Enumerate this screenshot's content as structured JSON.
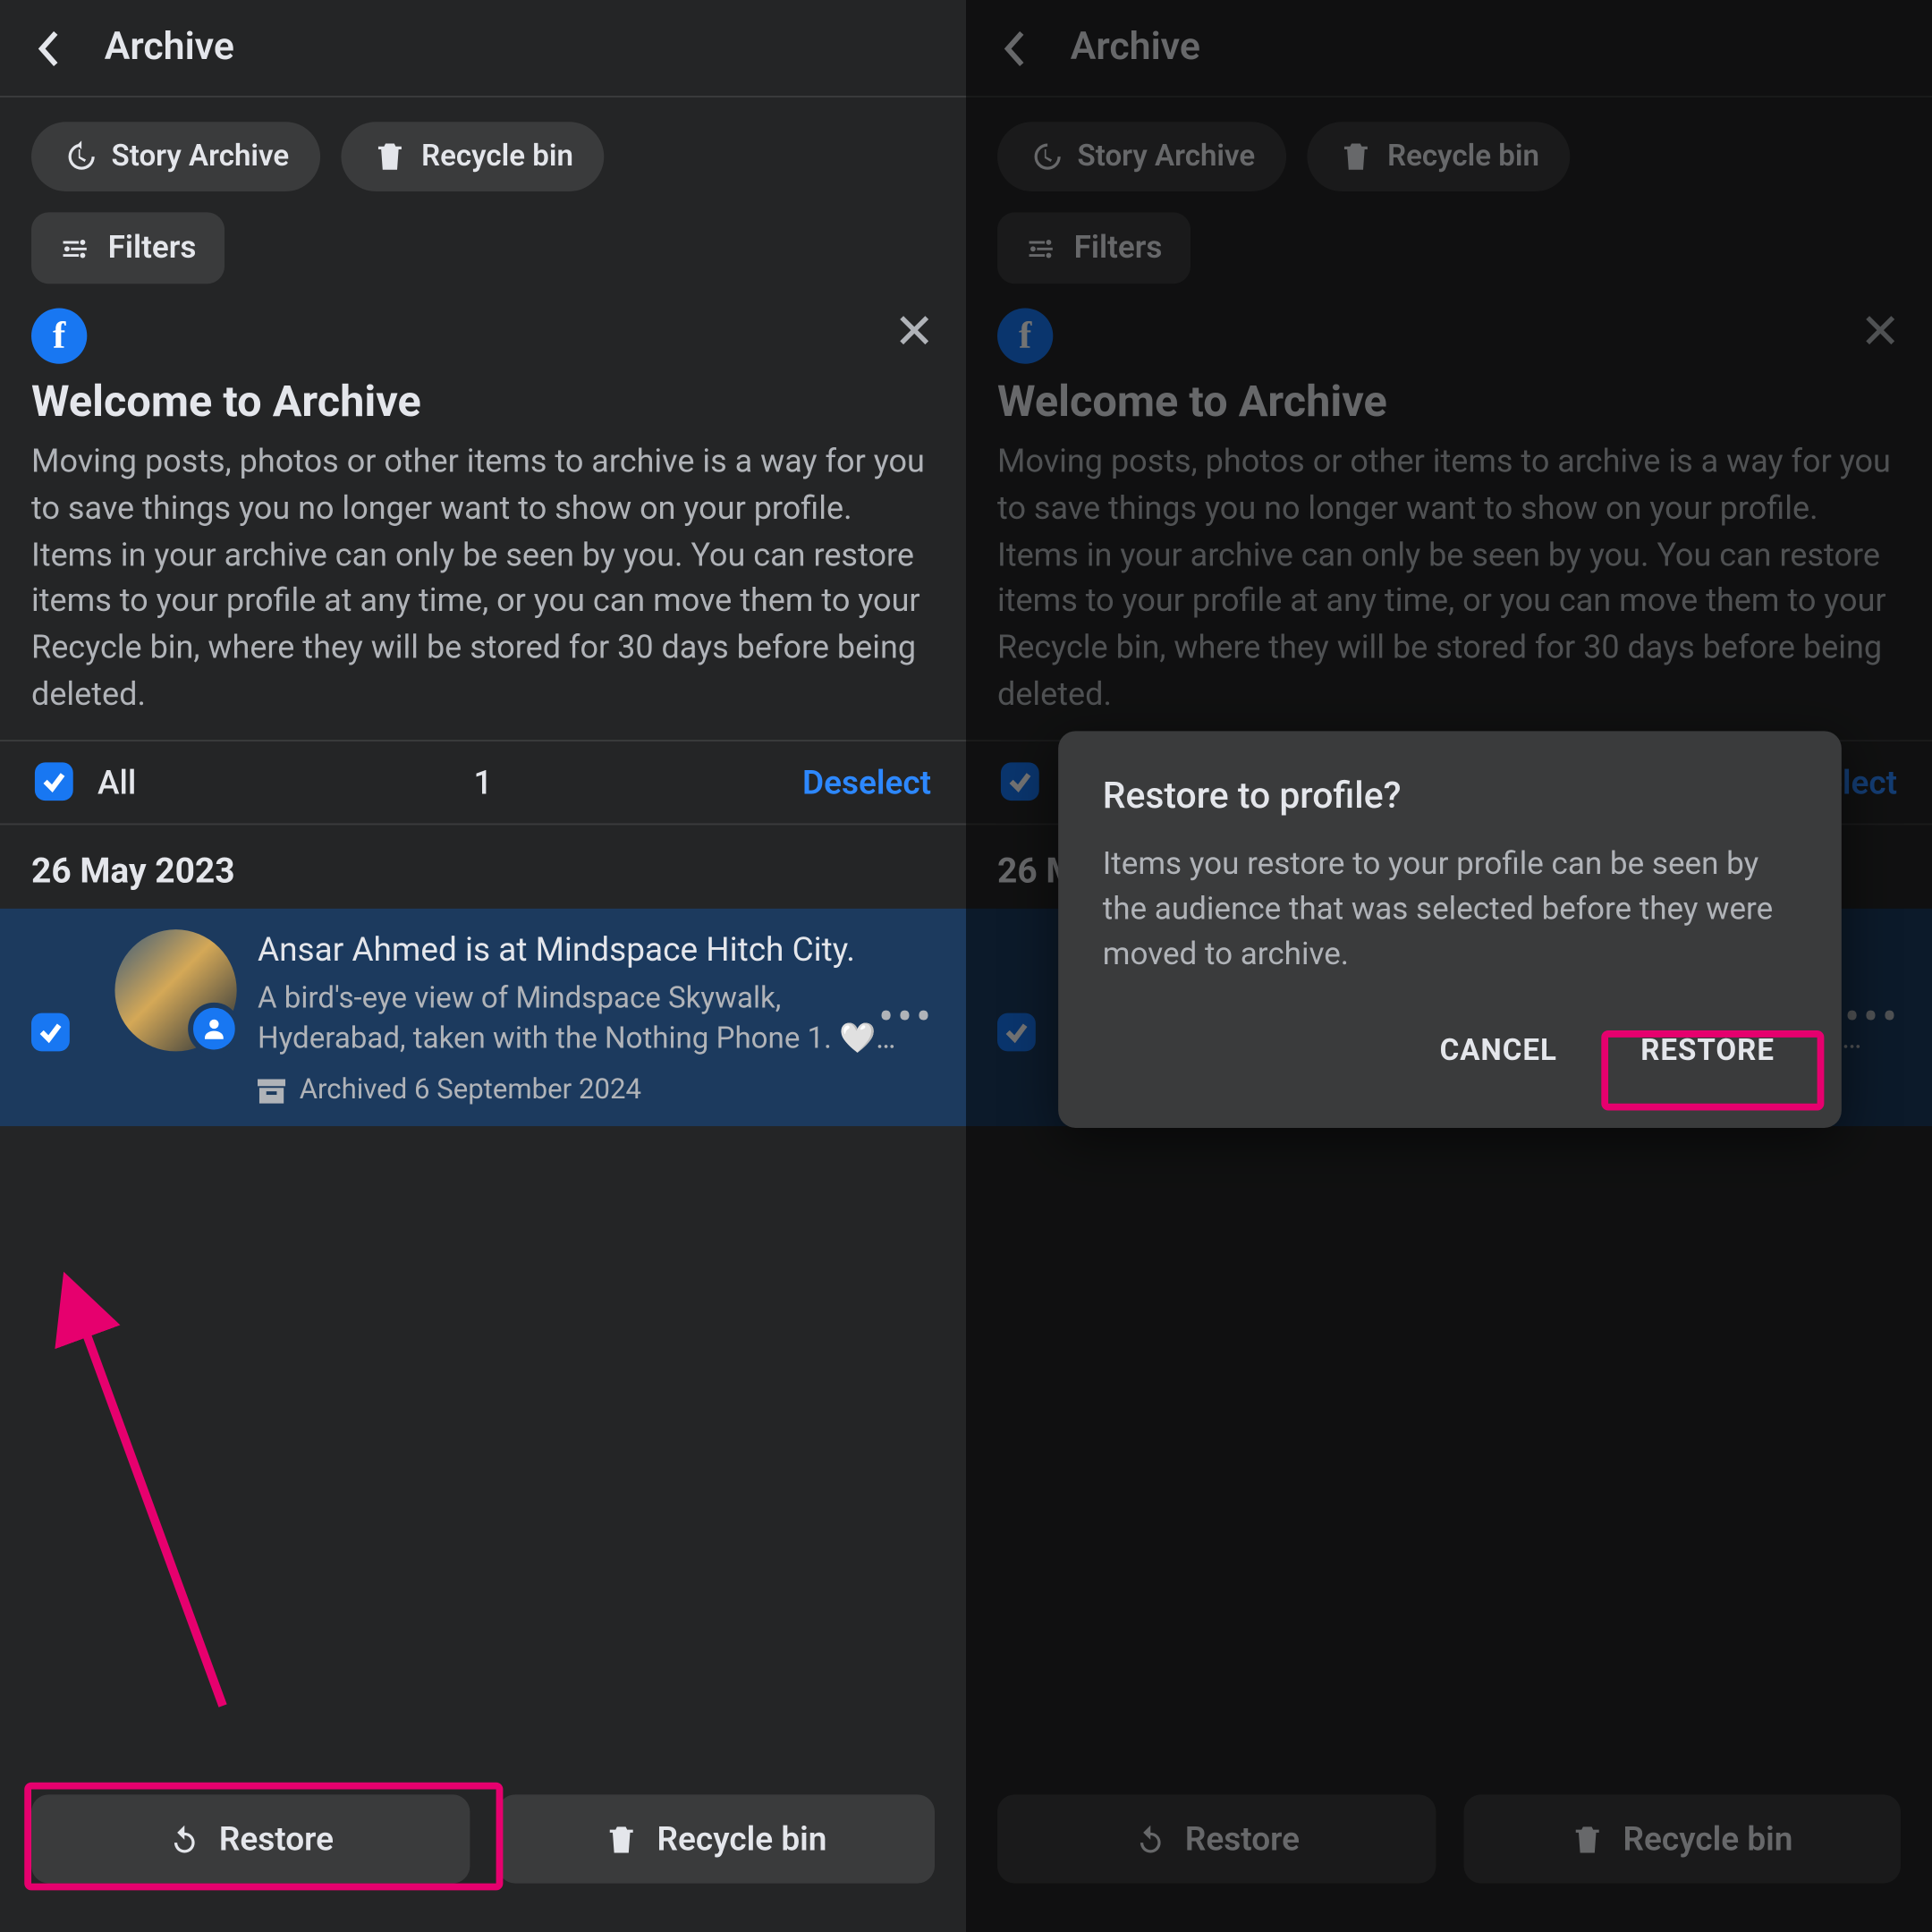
{
  "header": {
    "title": "Archive"
  },
  "chips": {
    "story_archive": "Story Archive",
    "recycle_bin": "Recycle bin"
  },
  "filters": {
    "label": "Filters"
  },
  "welcome": {
    "title": "Welcome to Archive",
    "body": "Moving posts, photos or other items to archive is a way for you to save things you no longer want to show on your profile. Items in your archive can only be seen by you. You can restore items to your profile at any time, or you can move them to your Recycle bin, where they will be stored for 30 days before being deleted."
  },
  "selection": {
    "all_label": "All",
    "count": "1",
    "deselect": "Deselect"
  },
  "date_group": "26 May 2023",
  "post": {
    "title": "Ansar Ahmed is at Mindspace Hitch City.",
    "desc_pre": "A bird's-eye view of Mindspace Skywalk, Hyderabad, taken with the Nothing Phone 1. ",
    "desc_post": "…",
    "archived": "Archived 6 September 2024"
  },
  "bottom": {
    "restore": "Restore",
    "recycle": "Recycle bin"
  },
  "dialog": {
    "title": "Restore to profile?",
    "body": "Items you restore to your profile can be seen by the audience that was selected before they were moved to archive.",
    "cancel": "CANCEL",
    "restore": "RESTORE"
  }
}
